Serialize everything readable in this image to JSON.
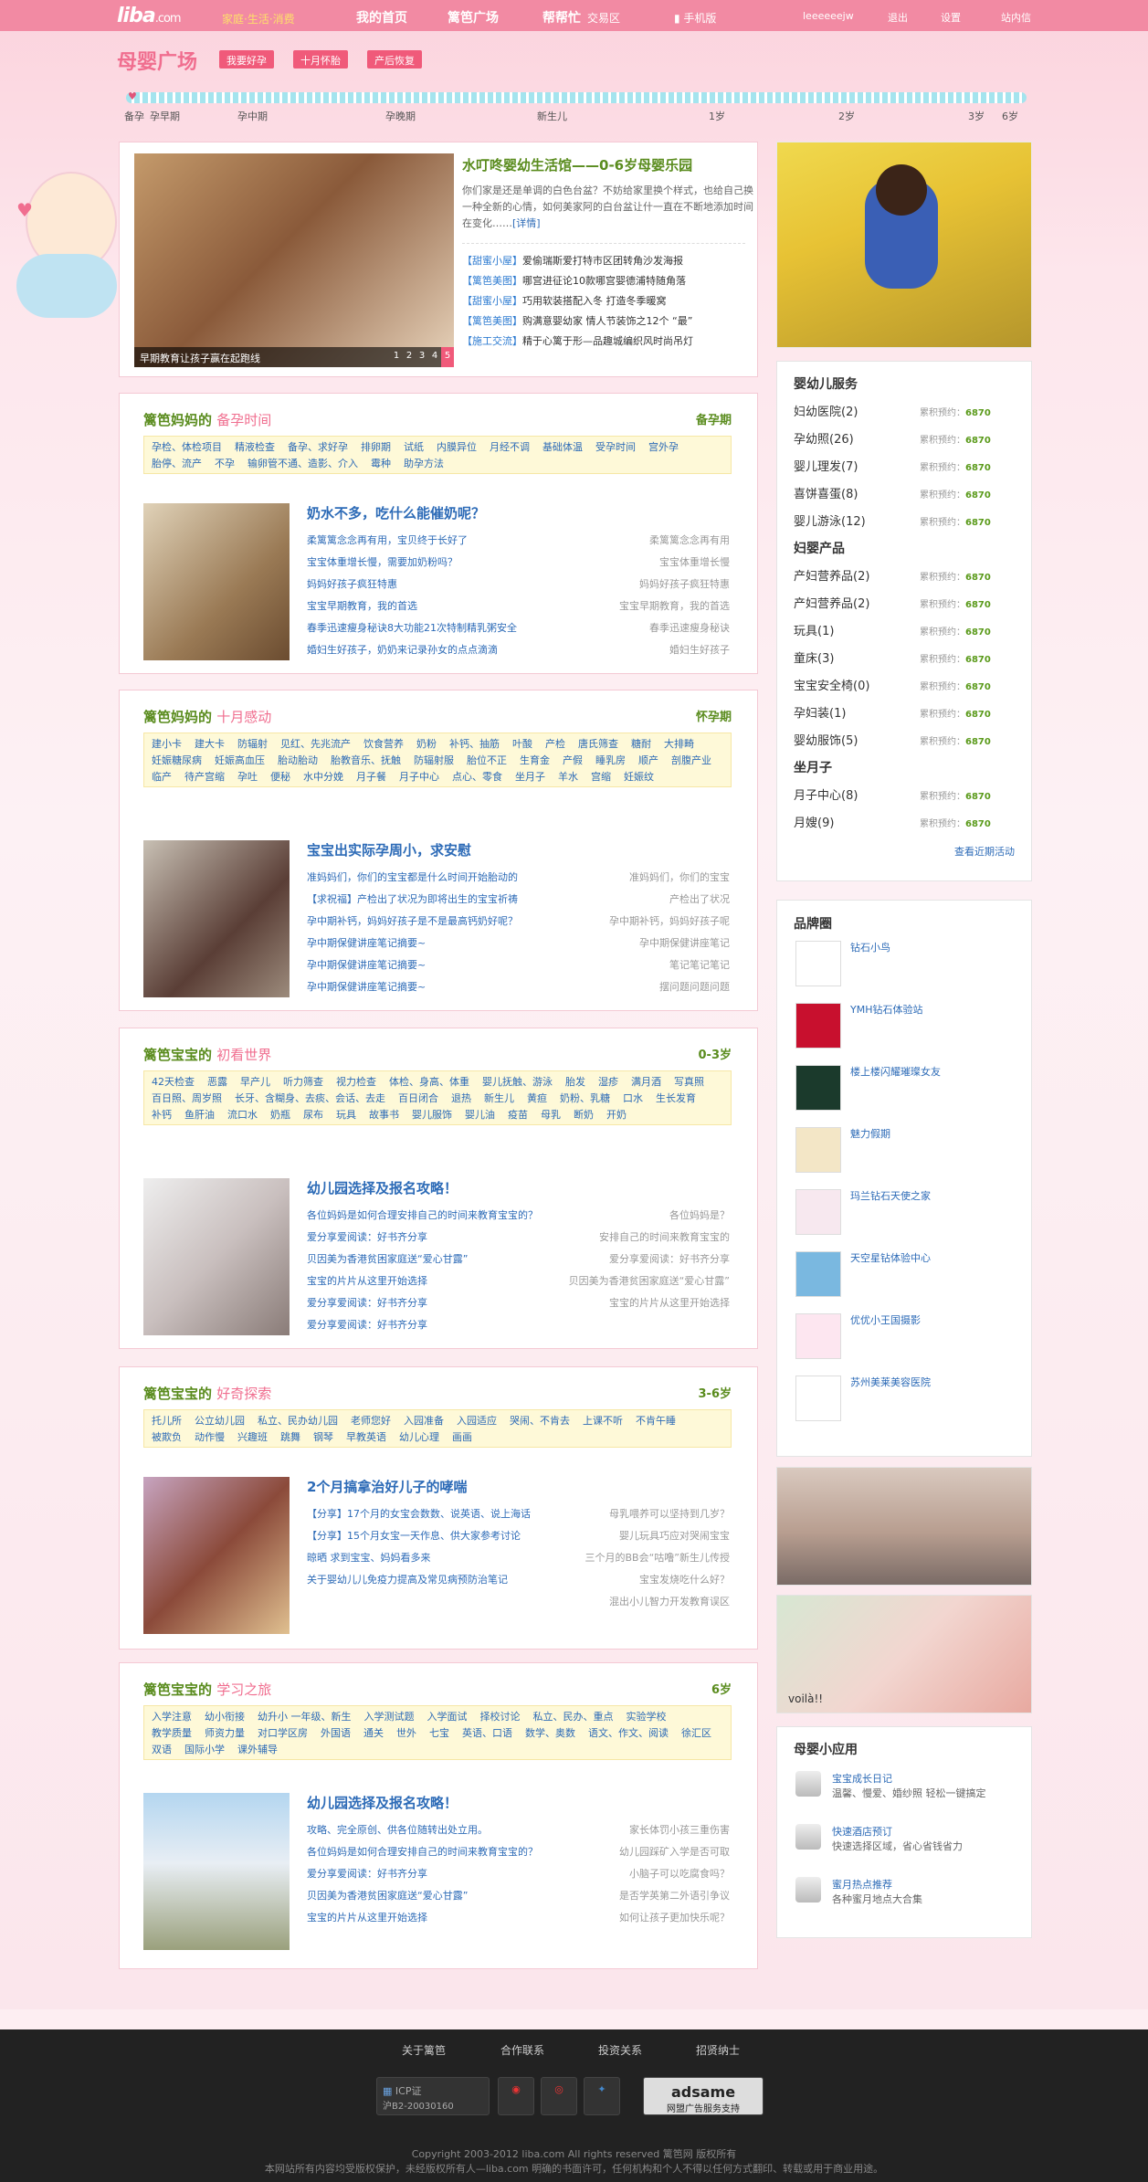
{
  "topbar": {
    "logo": "liba",
    "logo_suffix": ".com",
    "slogan": "家庭·生活·消费",
    "nav": [
      "我的首页",
      "篱笆广场",
      "帮帮忙",
      "交易区",
      "手机版"
    ],
    "username": "leeeeeejw",
    "links": [
      "退出",
      "设置",
      "站内信"
    ]
  },
  "banner": {
    "title": "母婴广场",
    "buttons": [
      "我要好孕",
      "十月怀胎",
      "产后恢复"
    ]
  },
  "timeline": [
    "备孕",
    "孕早期",
    "孕中期",
    "孕晚期",
    "新生儿",
    "1岁",
    "2岁",
    "3岁",
    "6岁"
  ],
  "feature": {
    "caption": "早期教育让孩子赢在起跑线",
    "pages": [
      "1",
      "2",
      "3",
      "4",
      "5"
    ],
    "title": "水叮咚婴幼生活馆——0-6岁母婴乐园",
    "desc": "你们家是还是单调的白色台盆？不妨给家里换个样式，也给自己换一种全新的心情，如何美家阿的白台盆让什一直在不断地添加时间在变化……",
    "more": "[详情]",
    "items": [
      {
        "tag": "【甜蜜小屋】",
        "text": "爱偷瑞斯爱打特市区团转角沙发海报"
      },
      {
        "tag": "【篱笆美图】",
        "text": "哪宫进征论10款哪宫婴德浦特随角落"
      },
      {
        "tag": "【甜蜜小屋】",
        "text": "巧用软装搭配入冬 打造冬季暖窝"
      },
      {
        "tag": "【篱笆美图】",
        "text": "购满意婴幼家 情人节装饰之12个 “最”"
      },
      {
        "tag": "【施工交流】",
        "text": "精于心篱于形—品趣城编织风时尚吊灯"
      }
    ]
  },
  "sections": [
    {
      "prefix": "篱笆妈妈的",
      "title": "备孕时间",
      "stage": "备孕期",
      "tags": [
        "孕检、体检项目",
        "精液检查",
        "备孕、求好孕",
        "排卵期",
        "试纸",
        "内膜异位",
        "月经不调",
        "基础体温",
        "受孕时间",
        "宫外孕",
        "胎停、流产",
        "不孕",
        "输卵管不通、造影、介入",
        "霉种",
        "助孕方法"
      ],
      "headline": "奶水不多，吃什么能催奶呢？",
      "left": [
        "柔篱篱念念再有用，宝贝终于长好了",
        "宝宝体重增长慢，需要加奶粉吗？",
        "妈妈好孩子疯狂特惠",
        "宝宝早期教育，我的首选",
        "春季迅速瘦身秘诀8大功能21次特制精乳粥安全",
        "婚妇生好孩子，奶奶来记录孙女的点点滴滴"
      ],
      "right": [
        "柔篱篱念念再有用",
        "宝宝体重增长慢",
        "妈妈好孩子疯狂特惠",
        "宝宝早期教育，我的首选",
        "春季迅速瘦身秘诀",
        "婚妇生好孩子"
      ]
    },
    {
      "prefix": "篱笆妈妈的",
      "title": "十月感动",
      "stage": "怀孕期",
      "tags": [
        "建小卡",
        "建大卡",
        "防辐射",
        "见红、先兆流产",
        "饮食营养",
        "奶粉",
        "补钙、抽筋",
        "叶酸",
        "产检",
        "唐氏筛查",
        "糖耐",
        "大排畸",
        "妊娠糖尿病",
        "妊娠高血压",
        "胎动胎动",
        "胎教音乐、抚触",
        "防辐射服",
        "胎位不正",
        "生育金",
        "产假",
        "睡乳房",
        "顺产",
        "剖腹产业",
        "临产",
        "待产宫缩",
        "孕吐",
        "便秘",
        "水中分娩",
        "月子餐",
        "月子中心",
        "点心、零食",
        "坐月子",
        "羊水",
        "宫缩",
        "妊娠纹"
      ],
      "headline": "宝宝出实际孕周小，求安慰",
      "left": [
        "准妈妈们，你们的宝宝都是什么时间开始胎动的",
        "【求祝福】产检出了状况为即将出生的宝宝祈祷",
        "孕中期补钙，妈妈好孩子是不是最高钙奶好呢？",
        "孕中期保健讲座笔记摘要~",
        "孕中期保健讲座笔记摘要~",
        "孕中期保健讲座笔记摘要~"
      ],
      "right": [
        "准妈妈们，你们的宝宝",
        "产检出了状况",
        "孕中期补钙，妈妈好孩子呢",
        "孕中期保健讲座笔记",
        "笔记笔记笔记",
        "摆问题问题问题"
      ]
    },
    {
      "prefix": "篱笆宝宝的",
      "title": "初看世界",
      "stage": "0-3岁",
      "tags": [
        "42天检查",
        "恶露",
        "早产儿",
        "听力筛查",
        "视力检查",
        "体检、身高、体重",
        "婴儿抚触、游泳",
        "胎发",
        "湿疹",
        "满月酒",
        "写真照",
        "百日照、周岁照",
        "长牙、含糊身、去痰、会话、去走",
        "百日闭合",
        "退热",
        "新生儿",
        "黄疸",
        "奶粉、乳糖",
        "口水",
        "生长发育",
        "补钙",
        "鱼肝油",
        "流口水",
        "奶瓶",
        "尿布",
        "玩具",
        "故事书",
        "婴儿服饰",
        "婴儿油",
        "疫苗",
        "母乳",
        "断奶",
        "开奶"
      ],
      "headline": "幼儿园选择及报名攻略！",
      "left": [
        "各位妈妈是如何合理安排自己的时间来教育宝宝的？",
        "爱分享爱阅读：好书齐分享",
        "贝因美为香港贫困家庭送“爱心甘露”",
        "宝宝的片片从这里开始选择",
        "爱分享爱阅读：好书齐分享",
        "爱分享爱阅读：好书齐分享"
      ],
      "right": [
        "各位妈妈是？",
        "安排自己的时间来教育宝宝的",
        "爱分享爱阅读：好书齐分享",
        "贝因美为香港贫困家庭送“爱心甘露”",
        "宝宝的片片从这里开始选择",
        ""
      ]
    },
    {
      "prefix": "篱笆宝宝的",
      "title": "好奇探索",
      "stage": "3-6岁",
      "tags": [
        "托儿所",
        "公立幼儿园",
        "私立、民办幼儿园",
        "老师您好",
        "入园准备",
        "入园适应",
        "哭闹、不肯去",
        "上课不听",
        "不肯午睡",
        "被欺负",
        "动作慢",
        "兴趣班",
        "跳舞",
        "钢琴",
        "早教英语",
        "幼儿心理",
        "画画"
      ],
      "headline": "2个月搞拿治好儿子的哮喘",
      "left": [
        "【分享】17个月的女宝会数数、说英语、说上海话",
        "【分享】15个月女宝一天作息、供大家参考讨论",
        "晾晒 求到宝宝、妈妈看多来",
        "关于婴幼儿儿免疫力提高及常见病预防治笔记"
      ],
      "right": [
        "母乳喂养可以坚持到几岁？",
        "婴儿玩具巧应对哭闹宝宝",
        "三个月的BB会“咕噜”新生儿传授",
        "宝宝发烧吃什么好？",
        "混出小儿智力开发教育误区"
      ]
    },
    {
      "prefix": "篱笆宝宝的",
      "title": "学习之旅",
      "stage": "6岁",
      "tags": [
        "入学注意",
        "幼小衔接",
        "幼升小 一年级、新生",
        "入学测试题",
        "入学面试",
        "择校讨论",
        "私立、民办、重点",
        "实验学校",
        "教学质量",
        "师资力量",
        "对口学区房",
        "外国语",
        "通关",
        "世外",
        "七宝",
        "英语、口语",
        "数学、奥数",
        "语文、作文、阅读",
        "徐汇区",
        "双语",
        "国际小学",
        "课外辅导"
      ],
      "headline": "幼儿园选择及报名攻略！",
      "left": [
        "攻略、完全原创、供各位随转出处立用。",
        "各位妈妈是如何合理安排自己的时间来教育宝宝的？",
        "爱分享爱阅读：好书齐分享",
        "贝因美为香港贫困家庭送“爱心甘露”",
        "宝宝的片片从这里开始选择"
      ],
      "right": [
        "家长体罚小孩三重伤害",
        "幼儿园踩矿入学是否可取",
        "小脑子可以吃腐食吗？",
        "是否学英第二外语引争议",
        "如何让孩子更加快乐呢？"
      ]
    }
  ],
  "services": {
    "cnt_label": "累积预约：",
    "cnt_value": "6870",
    "groups": [
      {
        "title": "婴幼儿服务",
        "items": [
          "妇幼医院(2)",
          "孕幼照(26)",
          "婴儿理发(7)",
          "喜饼喜蛋(8)",
          "婴儿游泳(12)"
        ]
      },
      {
        "title": "妇婴产品",
        "items": [
          "产妇营养品(2)",
          "产妇营养品(2)",
          "玩具(1)",
          "童床(3)",
          "宝宝安全椅(0)",
          "孕妇装(1)",
          "婴幼服饰(5)"
        ]
      },
      {
        "title": "坐月子",
        "items": [
          "月子中心(8)",
          "月嫂(9)"
        ]
      }
    ],
    "more": "查看近期活动"
  },
  "brands": {
    "title": "品牌圈",
    "items": [
      "钻石小鸟",
      "YMH钻石体验站",
      "楼上楼闪耀璀璨女友",
      "魅力假期",
      "玛兰钻石天使之家",
      "天空星钻体验中心",
      "优优小王国摄影",
      "苏州美莱美容医院"
    ]
  },
  "apps": {
    "title": "母婴小应用",
    "items": [
      {
        "name": "宝宝成长日记",
        "desc": "温馨、慢爱、婚纱照 轻松一键搞定"
      },
      {
        "name": "快速酒店预订",
        "desc": "快速选择区域，省心省钱省力"
      },
      {
        "name": "蜜月热点推荐",
        "desc": "各种蜜月地点大合集"
      }
    ]
  },
  "photo_caption": "voilà!!",
  "footer": {
    "links": [
      "关于篱笆",
      "合作联系",
      "投资关系",
      "招贤纳士"
    ],
    "icp": "ICP证",
    "icp_no": "沪B2-20030160",
    "adsame": "adsame",
    "adsame_sub": "网盟广告服务支持",
    "copyright": "Copyright 2003-2012 liba.com All rights reserved 篱笆网 版权所有",
    "notice": "本网站所有内容均受版权保护，未经版权所有人—liba.com 明确的书面许可，任何机构和个人不得以任何方式翻印、转载或用于商业用途。"
  },
  "colors": {
    "brand": "#f28aa3",
    "accent": "#f05a7a",
    "green": "#5a8c1e",
    "link": "#2d6bb7"
  }
}
